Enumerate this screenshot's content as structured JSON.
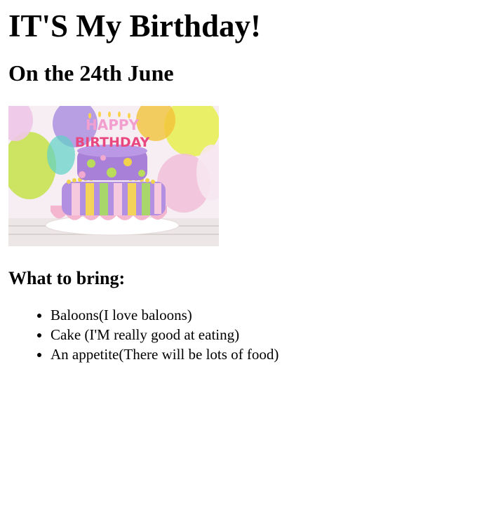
{
  "page": {
    "title": "IT'S My Birthday!",
    "subtitle": "On the 24th June",
    "image": {
      "topper_line1": "HAPPY",
      "topper_line2": "BIRTHDAY"
    },
    "bring_heading": "What to bring:",
    "bring_items": [
      "Baloons(I love baloons)",
      "Cake (I'M really good at eating)",
      "An appetite(There will be lots of food)"
    ]
  }
}
